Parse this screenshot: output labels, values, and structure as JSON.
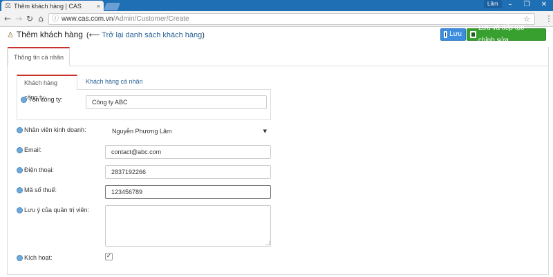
{
  "browser": {
    "tab_title": "Thêm khách hàng | CAS",
    "tab_close": "×",
    "user_badge": "Lâm",
    "url_host": "www.cas.com.vn",
    "url_path": "/Admin/Customer/Create"
  },
  "header": {
    "title": "Thêm khách hàng",
    "back_open": "(",
    "back_arrow": "⟵",
    "back_link": "Trở lại danh sách khách hàng",
    "back_close": ")",
    "save_label": "Lưu",
    "save_continue_label": "Lưu và tiếp tục chỉnh sửa"
  },
  "outer_tabs": [
    "Thông tin cá nhân"
  ],
  "inner_tabs": [
    "Khách hàng công ty",
    "Khách hàng cá nhân"
  ],
  "form": {
    "company_label": "Tên công ty:",
    "company_value": "Công ty ABC",
    "sales_label": "Nhân viên kinh doanh:",
    "sales_value": "Nguyễn Phương Lâm",
    "email_label": "Email:",
    "email_value": "contact@abc.com",
    "phone_label": "Điện thoại:",
    "phone_value": "2837192266",
    "tax_label": "Mã số thuế:",
    "tax_value": "123456789",
    "note_label": "Lưu ý của quản trị viên:",
    "note_value": "",
    "active_label": "Kích hoạt:",
    "active_checked": true
  },
  "colors": {
    "titlebar": "#1f6fb5",
    "save_button": "#3c8dde",
    "save_continue_button": "#38a02f",
    "active_tab_accent": "#c9302c",
    "link": "#2a6496"
  }
}
